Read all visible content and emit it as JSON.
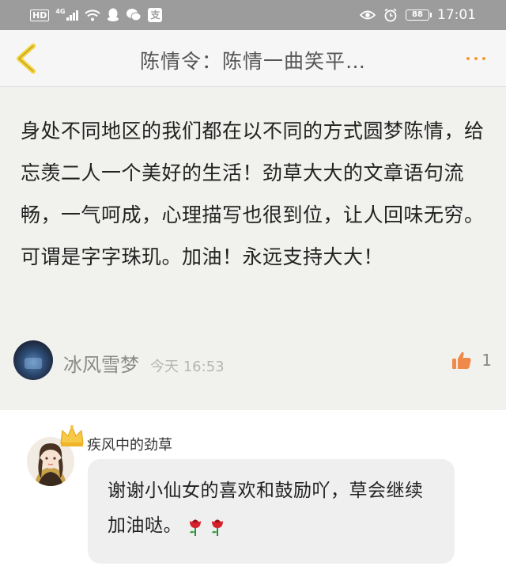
{
  "status_bar": {
    "hd": "HD",
    "network": "4G",
    "pay_glyph": "支",
    "battery": "88",
    "time": "17:01",
    "icons": [
      "signal-icon",
      "wifi-icon",
      "qq-icon",
      "wechat-icon",
      "alipay-icon",
      "eye-icon",
      "alarm-icon",
      "battery-icon"
    ]
  },
  "nav": {
    "title": "陈情令：陈情一曲笑平…",
    "back_icon": "chevron-left-icon",
    "more_icon": "more-dots-icon",
    "accent": "#f29b2a"
  },
  "comment": {
    "text": "身处不同地区的我们都在以不同的方式圆梦陈情，给忘羡二人一个美好的生活！劲草大大的文章语句流畅，一气呵成，心理描写也很到位，让人回味无穷。可谓是字字珠玑。加油！永远支持大大！",
    "username": "冰风雪梦",
    "timestamp": "今天 16:53",
    "like_count": "1",
    "like_icon": "thumbs-up-icon"
  },
  "reply": {
    "author": "疾风中的劲草",
    "text": "谢谢小仙女的喜欢和鼓励吖，草会继续加油哒。",
    "author_badge": "crown-icon",
    "emoji": [
      "rose-icon",
      "rose-icon"
    ]
  }
}
